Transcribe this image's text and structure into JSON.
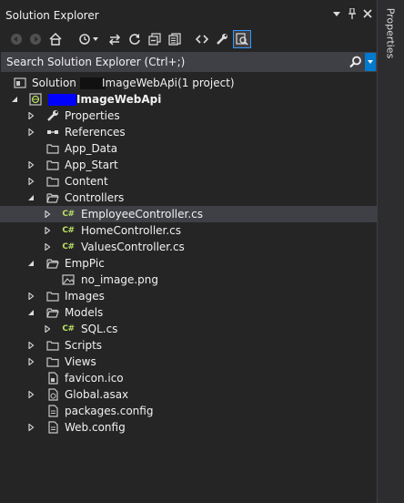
{
  "window": {
    "title": "Solution Explorer"
  },
  "side_tab": {
    "label": "Properties"
  },
  "search": {
    "placeholder": "Search Solution Explorer (Ctrl+;)"
  },
  "tree": {
    "solution_prefix": "Solution '",
    "solution_name": "ImageWebApi",
    "solution_suffix": "' (1 project)",
    "project_name": "ImageWebApi",
    "items": [
      {
        "label": "Properties"
      },
      {
        "label": "References"
      },
      {
        "label": "App_Data"
      },
      {
        "label": "App_Start"
      },
      {
        "label": "Content"
      },
      {
        "label": "Controllers"
      },
      {
        "label": "EmployeeController.cs"
      },
      {
        "label": "HomeController.cs"
      },
      {
        "label": "ValuesController.cs"
      },
      {
        "label": "EmpPic"
      },
      {
        "label": "no_image.png"
      },
      {
        "label": "Images"
      },
      {
        "label": "Models"
      },
      {
        "label": "SQL.cs"
      },
      {
        "label": "Scripts"
      },
      {
        "label": "Views"
      },
      {
        "label": "favicon.ico"
      },
      {
        "label": "Global.asax"
      },
      {
        "label": "packages.config"
      },
      {
        "label": "Web.config"
      }
    ],
    "cs_badge": "C#"
  },
  "colors": {
    "accent": "#007acc",
    "redaction_black": "#111111",
    "redaction_blue": "#0000ff"
  }
}
